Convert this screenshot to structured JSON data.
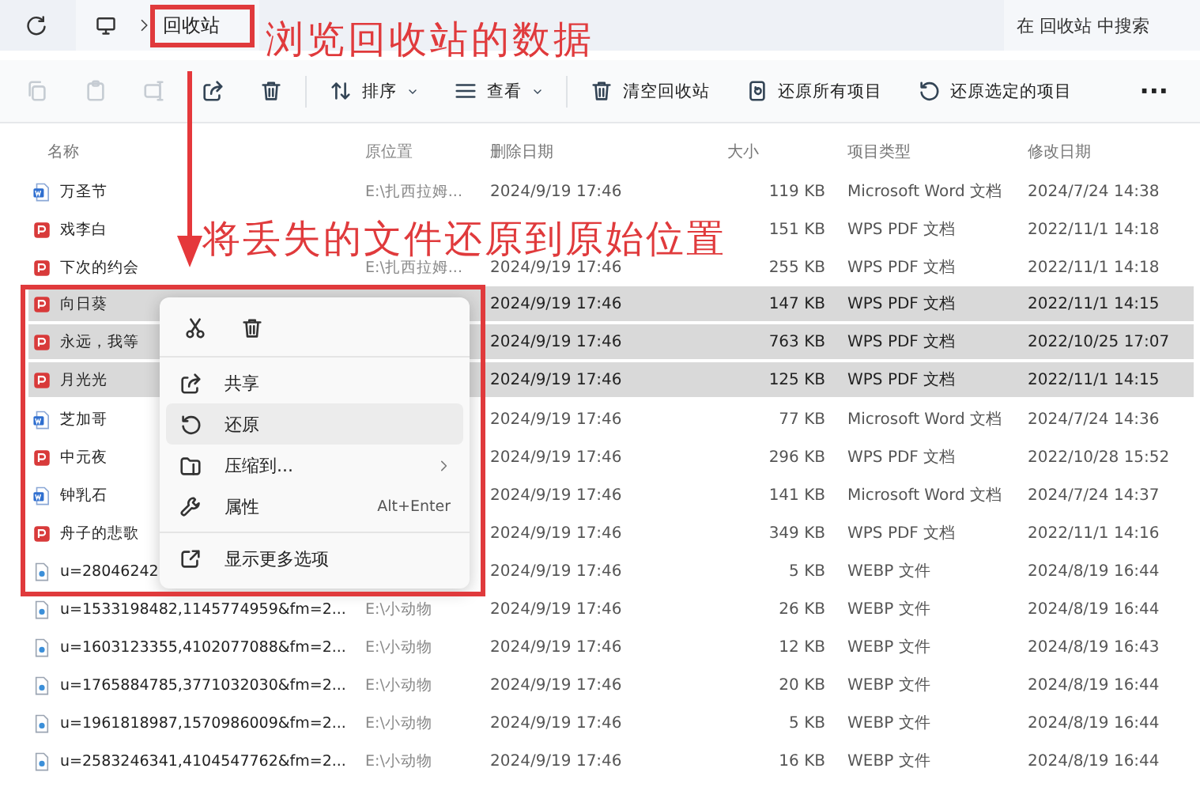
{
  "address_bar": {
    "crumb": "回收站"
  },
  "search": {
    "placeholder": "在 回收站 中搜索"
  },
  "toolbar": [
    {
      "kind": "icon",
      "disabled": true
    },
    {
      "kind": "icon",
      "disabled": true
    },
    {
      "kind": "icon",
      "disabled": true
    },
    {
      "kind": "icon",
      "disabled": false
    },
    {
      "kind": "icon",
      "disabled": false
    },
    {
      "kind": "dropdown",
      "label": "排序"
    },
    {
      "kind": "dropdown",
      "label": "查看"
    },
    {
      "kind": "button",
      "label": "清空回收站"
    },
    {
      "kind": "button",
      "label": "还原所有项目"
    },
    {
      "kind": "button",
      "label": "还原选定的项目"
    },
    {
      "kind": "more",
      "label": "···"
    }
  ],
  "table": {
    "columns": [
      "名称",
      "原位置",
      "删除日期",
      "大小",
      "项目类型",
      "修改日期"
    ],
    "rows": [
      {
        "kind": "word",
        "name": "万圣节",
        "location": "E:\\扎西拉姆...",
        "deleted": "2024/9/19 17:46",
        "size": "119 KB",
        "type": "Microsoft Word 文档",
        "modified": "2024/7/24 14:38",
        "selected": false
      },
      {
        "kind": "pdf",
        "name": "戏李白",
        "size": "151 KB",
        "type": "WPS PDF 文档",
        "modified": "2022/11/1 14:18",
        "selected": false
      },
      {
        "kind": "pdf",
        "name": "下次的约会",
        "location": "E:\\扎西拉姆...",
        "deleted": "2024/9/19 17:46",
        "size": "255 KB",
        "type": "WPS PDF 文档",
        "modified": "2022/11/1 14:18",
        "selected": false
      },
      {
        "kind": "pdf",
        "name": "向日葵",
        "deleted": "2024/9/19 17:46",
        "size": "147 KB",
        "type": "WPS PDF 文档",
        "modified": "2022/11/1 14:15",
        "selected": true
      },
      {
        "kind": "pdf",
        "name": "永远，我等",
        "deleted": "2024/9/19 17:46",
        "size": "763 KB",
        "type": "WPS PDF 文档",
        "modified": "2022/10/25 17:07",
        "selected": true
      },
      {
        "kind": "pdf",
        "name": "月光光",
        "deleted": "2024/9/19 17:46",
        "size": "125 KB",
        "type": "WPS PDF 文档",
        "modified": "2022/11/1 14:15",
        "selected": true
      },
      {
        "kind": "word",
        "name": "芝加哥",
        "deleted": "2024/9/19 17:46",
        "size": "77 KB",
        "type": "Microsoft Word 文档",
        "modified": "2024/7/24 14:36",
        "selected": false
      },
      {
        "kind": "pdf",
        "name": "中元夜",
        "deleted": "2024/9/19 17:46",
        "size": "296 KB",
        "type": "WPS PDF 文档",
        "modified": "2022/10/28 15:52",
        "selected": false
      },
      {
        "kind": "word",
        "name": "钟乳石",
        "deleted": "2024/9/19 17:46",
        "size": "141 KB",
        "type": "Microsoft Word 文档",
        "modified": "2024/7/24 14:37",
        "selected": false
      },
      {
        "kind": "pdf",
        "name": "舟子的悲歌",
        "deleted": "2024/9/19 17:46",
        "size": "349 KB",
        "type": "WPS PDF 文档",
        "modified": "2022/11/1 14:16",
        "selected": false
      },
      {
        "kind": "image",
        "name": "u=28046242",
        "deleted": "2024/9/19 17:46",
        "size": "5 KB",
        "type": "WEBP 文件",
        "modified": "2024/8/19 16:44",
        "selected": false
      },
      {
        "kind": "image",
        "name": "u=1533198482,1145774959&fm=2...",
        "location": "E:\\小动物",
        "deleted": "2024/9/19 17:46",
        "size": "26 KB",
        "type": "WEBP 文件",
        "modified": "2024/8/19 16:44",
        "selected": false
      },
      {
        "kind": "image",
        "name": "u=1603123355,4102077088&fm=2...",
        "location": "E:\\小动物",
        "deleted": "2024/9/19 17:46",
        "size": "12 KB",
        "type": "WEBP 文件",
        "modified": "2024/8/19 16:43",
        "selected": false
      },
      {
        "kind": "image",
        "name": "u=1765884785,3771032030&fm=2...",
        "location": "E:\\小动物",
        "deleted": "2024/9/19 17:46",
        "size": "20 KB",
        "type": "WEBP 文件",
        "modified": "2024/8/19 16:44",
        "selected": false
      },
      {
        "kind": "image",
        "name": "u=1961818987,1570986009&fm=2...",
        "location": "E:\\小动物",
        "deleted": "2024/9/19 17:46",
        "size": "5 KB",
        "type": "WEBP 文件",
        "modified": "2024/8/19 16:44",
        "selected": false
      },
      {
        "kind": "image",
        "name": "u=2583246341,4104547762&fm=2...",
        "location": "E:\\小动物",
        "deleted": "2024/9/19 17:46",
        "size": "16 KB",
        "type": "WEBP 文件",
        "modified": "2024/8/19 16:44",
        "selected": false
      }
    ]
  },
  "context_menu": {
    "items": [
      {
        "kind": "item",
        "label": "共享",
        "hovered": false
      },
      {
        "kind": "item",
        "label": "还原",
        "hovered": true
      },
      {
        "kind": "submenu",
        "label": "压缩到...",
        "hovered": false
      },
      {
        "kind": "item",
        "label": "属性",
        "shortcut": "Alt+Enter",
        "hovered": false
      },
      {
        "kind": "separator"
      },
      {
        "kind": "item",
        "label": "显示更多选项",
        "hovered": false
      }
    ]
  },
  "annotations": [
    {
      "kind": "text",
      "text": "浏览回收站的数据"
    },
    {
      "kind": "text",
      "text": "将丢失的文件还原到原始位置"
    }
  ]
}
